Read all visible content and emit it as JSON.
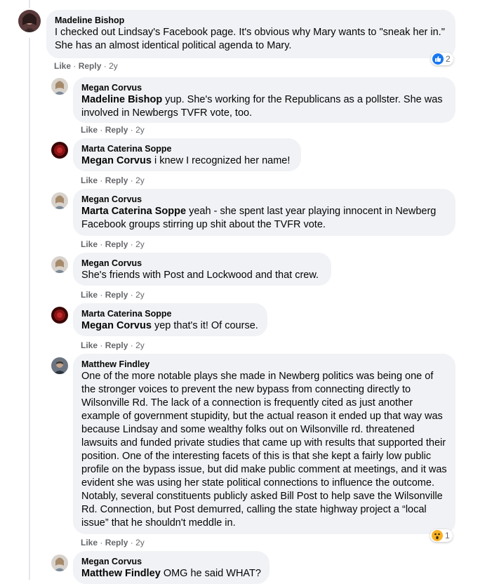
{
  "comments": [
    {
      "author": "Madeline Bishop",
      "mention": "",
      "text": "I checked out Lindsay's Facebook page. It's obvious why Mary wants to \"sneak her in.\" She has an almost identical political agenda to Mary.",
      "like": "Like",
      "reply": "Reply",
      "time": "2y",
      "reaction_count": "2"
    },
    {
      "author": "Megan Corvus",
      "mention": "Madeline Bishop",
      "text": "yup. She's working for the Republicans as a pollster. She was involved in Newbergs TVFR vote, too.",
      "like": "Like",
      "reply": "Reply",
      "time": "2y"
    },
    {
      "author": "Marta Caterina Soppe",
      "mention": "Megan Corvus",
      "text": "i knew I recognized her name!",
      "like": "Like",
      "reply": "Reply",
      "time": "2y"
    },
    {
      "author": "Megan Corvus",
      "mention": "Marta Caterina Soppe",
      "text": "yeah - she spent last year playing innocent in Newberg Facebook groups stirring up shit about the TVFR vote.",
      "like": "Like",
      "reply": "Reply",
      "time": "2y"
    },
    {
      "author": "Megan Corvus",
      "mention": "",
      "text": "She's friends with Post and Lockwood and that crew.",
      "like": "Like",
      "reply": "Reply",
      "time": "2y"
    },
    {
      "author": "Marta Caterina Soppe",
      "mention": "Megan Corvus",
      "text": "yep that's it! Of course.",
      "like": "Like",
      "reply": "Reply",
      "time": "2y"
    },
    {
      "author": "Matthew Findley",
      "mention": "",
      "text": "One of the more notable plays she made in Newberg politics was being one of the stronger voices to prevent the new bypass from connecting directly to Wilsonville Rd. The lack of a connection is frequently cited as just another example of government stupidity, but the actual reason it ended up that way was because Lindsay and some wealthy folks out on Wilsonville rd. threatened lawsuits and funded private studies that came up with results that supported their position. One of the interesting facets of this is that she kept a fairly low public profile on the bypass issue, but did make public comment at meetings, and it was evident she was using her state political connections to influence the outcome. Notably, several constituents publicly asked Bill Post to help save the Wilsonville Rd. Connection, but Post demurred, calling the state highway project a “local issue” that he shouldn't meddle in.",
      "like": "Like",
      "reply": "Reply",
      "time": "2y",
      "reaction_count": "1"
    },
    {
      "author": "Megan Corvus",
      "mention": "Matthew Findley",
      "text": "OMG he said WHAT?",
      "like": "",
      "reply": "",
      "time": ""
    }
  ],
  "meta_separator": "·",
  "icons": {
    "like_reaction": "thumbs-up-icon",
    "wow_reaction": "wow-face-icon"
  },
  "colors": {
    "bubble": "#f0f2f5",
    "like_blue": "#1877f2",
    "wow_yellow": "#f7b125"
  }
}
